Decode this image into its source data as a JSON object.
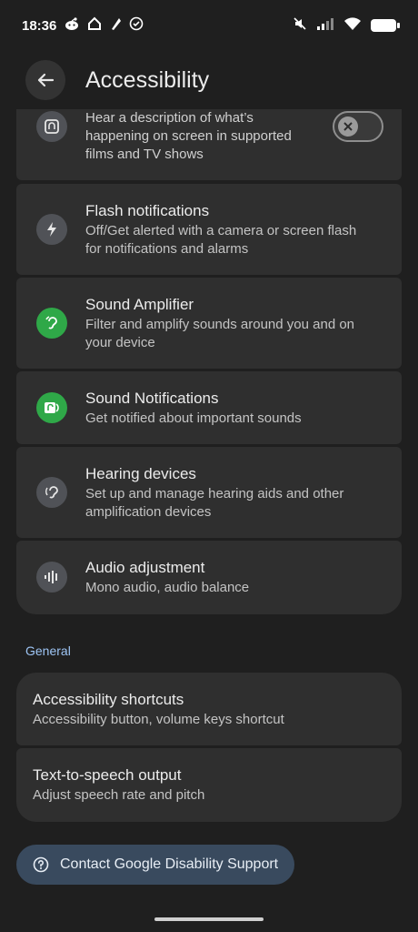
{
  "status_bar": {
    "time": "18:36",
    "left_icons": [
      "reddit-icon",
      "home-icon",
      "feather-icon",
      "check-circle-icon"
    ],
    "right_icons": [
      "mute-icon",
      "signal-icon",
      "wifi-icon",
      "battery-icon"
    ]
  },
  "app_bar": {
    "title": "Accessibility"
  },
  "items": [
    {
      "subtitle": "Hear a description of what’s happening on screen in supported films and TV shows",
      "icon": "audio-description-icon",
      "toggle_on": false
    },
    {
      "title": "Flash notifications",
      "subtitle": "Off/Get alerted with a camera or screen flash for notifications and alarms",
      "icon": "flash-icon"
    },
    {
      "title": "Sound Amplifier",
      "subtitle": "Filter and amplify sounds around you and on your device",
      "icon": "ear-icon",
      "icon_color": "#2fa848"
    },
    {
      "title": "Sound Notifications",
      "subtitle": "Get notified about important sounds",
      "icon": "sound-notification-icon",
      "icon_color": "#2fa848"
    },
    {
      "title": "Hearing devices",
      "subtitle": "Set up and manage hearing aids and other amplification devices",
      "icon": "hearing-icon"
    },
    {
      "title": "Audio adjustment",
      "subtitle": "Mono audio, audio balance",
      "icon": "audio-wave-icon"
    }
  ],
  "general": {
    "header": "General",
    "items": [
      {
        "title": "Accessibility shortcuts",
        "subtitle": "Accessibility button, volume keys shortcut"
      },
      {
        "title": "Text-to-speech output",
        "subtitle": "Adjust speech rate and pitch"
      }
    ]
  },
  "support": {
    "label": "Contact Google Disability Support",
    "icon": "help-icon"
  },
  "colors": {
    "background": "#1f1f1f",
    "card": "#2f2f2f",
    "accent_green": "#2fa848",
    "section_header": "#9ec5f5",
    "support_chip": "#394a5e"
  }
}
